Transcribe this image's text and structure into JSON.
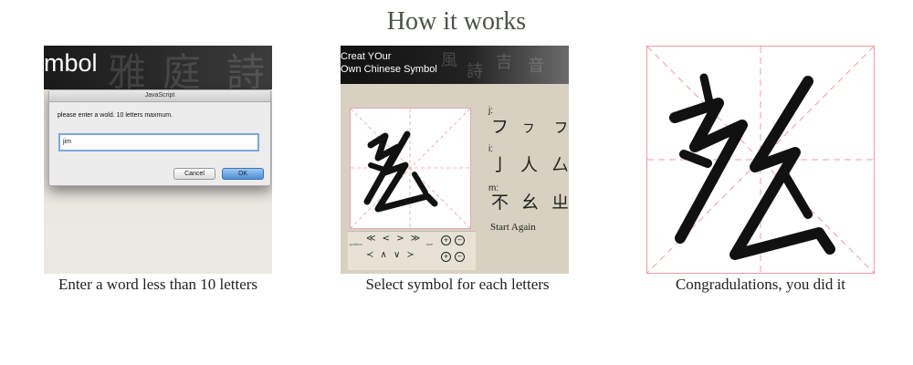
{
  "title": "How it works",
  "steps": [
    {
      "caption": "Enter a word less than 10 letters",
      "app_header": "mbol",
      "dialog": {
        "title": "JavaScript",
        "message": "please enter a wold. 10 letters maxmum.",
        "input_value": "jim",
        "cancel_label": "Cancel",
        "ok_label": "OK"
      }
    },
    {
      "caption": "Select symbol for each letters",
      "header_line1": "Creat YOur",
      "header_line2": "Own Chinese Symbol",
      "letters": [
        {
          "label": "j:",
          "options": [
            "フ",
            "ㇷ",
            "ㇷ"
          ]
        },
        {
          "label": "i:",
          "options": [
            "亅",
            "人",
            "厶"
          ]
        },
        {
          "label": "m:",
          "options": [
            "不",
            "幺",
            "ㄓ"
          ]
        }
      ],
      "start_again": "Start Again",
      "tool_labels": {
        "position": "position",
        "size": "size"
      },
      "arrows_row1": "≪ < > ≫",
      "arrows_row2": "≺ ∧ ∨ ≻",
      "zoom_in": "+",
      "zoom_out": "−"
    },
    {
      "caption": "Congradulations, you did it"
    }
  ],
  "colors": {
    "guide_pink": "#f29ca4",
    "title_color": "#4a5346",
    "ok_blue": "#4c8fd9"
  }
}
